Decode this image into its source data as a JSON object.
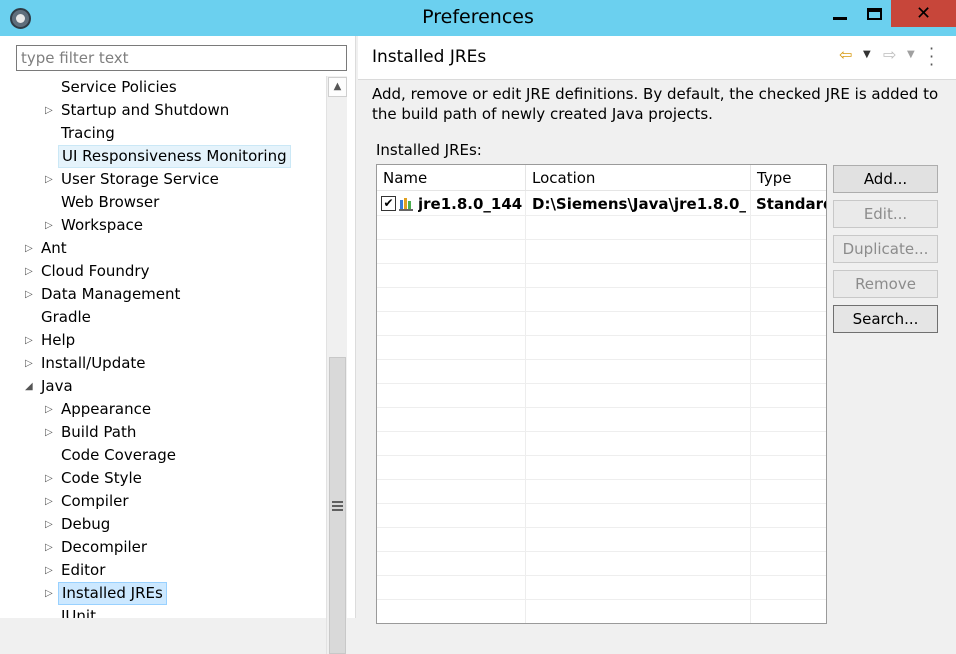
{
  "window": {
    "title": "Preferences",
    "minimize_icon": "minimize-icon",
    "maximize_icon": "maximize-icon",
    "close_glyph": "✕"
  },
  "filter": {
    "placeholder": "type filter text",
    "value": ""
  },
  "tree": {
    "items": [
      {
        "label": "Service Policies",
        "level": 1,
        "expandable": false,
        "expanded": false,
        "state": "normal"
      },
      {
        "label": "Startup and Shutdown",
        "level": 1,
        "expandable": true,
        "expanded": false,
        "state": "normal"
      },
      {
        "label": "Tracing",
        "level": 1,
        "expandable": false,
        "expanded": false,
        "state": "normal"
      },
      {
        "label": "UI Responsiveness Monitoring",
        "level": 1,
        "expandable": false,
        "expanded": false,
        "state": "hovered"
      },
      {
        "label": "User Storage Service",
        "level": 1,
        "expandable": true,
        "expanded": false,
        "state": "normal"
      },
      {
        "label": "Web Browser",
        "level": 1,
        "expandable": false,
        "expanded": false,
        "state": "normal"
      },
      {
        "label": "Workspace",
        "level": 1,
        "expandable": true,
        "expanded": false,
        "state": "normal"
      },
      {
        "label": "Ant",
        "level": 0,
        "expandable": true,
        "expanded": false,
        "state": "normal"
      },
      {
        "label": "Cloud Foundry",
        "level": 0,
        "expandable": true,
        "expanded": false,
        "state": "normal"
      },
      {
        "label": "Data Management",
        "level": 0,
        "expandable": true,
        "expanded": false,
        "state": "normal"
      },
      {
        "label": "Gradle",
        "level": 0,
        "expandable": false,
        "expanded": false,
        "state": "normal"
      },
      {
        "label": "Help",
        "level": 0,
        "expandable": true,
        "expanded": false,
        "state": "normal"
      },
      {
        "label": "Install/Update",
        "level": 0,
        "expandable": true,
        "expanded": false,
        "state": "normal"
      },
      {
        "label": "Java",
        "level": 0,
        "expandable": true,
        "expanded": true,
        "state": "normal"
      },
      {
        "label": "Appearance",
        "level": 1,
        "expandable": true,
        "expanded": false,
        "state": "normal"
      },
      {
        "label": "Build Path",
        "level": 1,
        "expandable": true,
        "expanded": false,
        "state": "normal"
      },
      {
        "label": "Code Coverage",
        "level": 1,
        "expandable": false,
        "expanded": false,
        "state": "normal"
      },
      {
        "label": "Code Style",
        "level": 1,
        "expandable": true,
        "expanded": false,
        "state": "normal"
      },
      {
        "label": "Compiler",
        "level": 1,
        "expandable": true,
        "expanded": false,
        "state": "normal"
      },
      {
        "label": "Debug",
        "level": 1,
        "expandable": true,
        "expanded": false,
        "state": "normal"
      },
      {
        "label": "Decompiler",
        "level": 1,
        "expandable": true,
        "expanded": false,
        "state": "normal"
      },
      {
        "label": "Editor",
        "level": 1,
        "expandable": true,
        "expanded": false,
        "state": "normal"
      },
      {
        "label": "Installed JREs",
        "level": 1,
        "expandable": true,
        "expanded": false,
        "state": "selected"
      },
      {
        "label": "JUnit",
        "level": 1,
        "expandable": false,
        "expanded": false,
        "state": "normal"
      }
    ]
  },
  "page": {
    "title": "Installed JREs",
    "description": "Add, remove or edit JRE definitions. By default, the checked JRE is added to the build path of newly created Java projects.",
    "list_label": "Installed JREs:",
    "nav_icons": {
      "back": "back-arrow-icon",
      "forward": "forward-arrow-icon",
      "menu": "view-menu-icon"
    }
  },
  "table": {
    "columns": [
      "Name",
      "Location",
      "Type"
    ],
    "rows": [
      {
        "checked": true,
        "name": "jre1.8.0_144...",
        "location": "D:\\Siemens\\Java\\jre1.8.0_...",
        "type": "Standard"
      }
    ]
  },
  "buttons": {
    "add": "Add...",
    "edit": "Edit...",
    "duplicate": "Duplicate...",
    "remove": "Remove",
    "search": "Search..."
  },
  "colors": {
    "titlebar": "#6bd0ef",
    "close_button": "#c7463a",
    "selection": "#cce8ff",
    "back_arrow": "#d79a12"
  }
}
